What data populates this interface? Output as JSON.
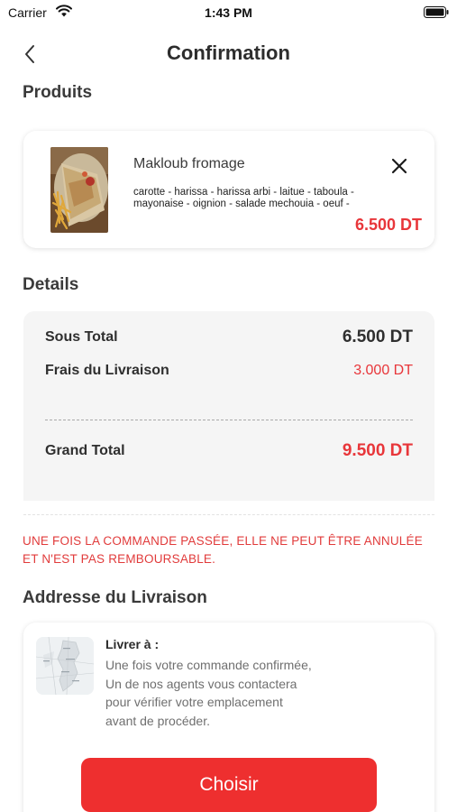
{
  "status_bar": {
    "carrier": "Carrier",
    "time": "1:43 PM"
  },
  "header": {
    "title": "Confirmation",
    "back_icon": "chevron-left-icon"
  },
  "products": {
    "section_title": "Produits",
    "items": [
      {
        "name": "Makloub fromage",
        "ingredients": "carotte - harissa - harissa arbi - laitue - taboula - mayonaise - oignion - salade mechouia - oeuf -",
        "price": "6.500 DT",
        "remove_icon": "close-icon"
      }
    ]
  },
  "details": {
    "section_title": "Details",
    "subtotal_label": "Sous Total",
    "subtotal_value": "6.500 DT",
    "delivery_label": "Frais du Livraison",
    "delivery_value": "3.000 DT",
    "total_label": "Grand Total",
    "total_value": "9.500 DT"
  },
  "warning": "UNE FOIS LA COMMANDE PASSÉE, ELLE NE PEUT ÊTRE ANNULÉE ET N'EST PAS REMBOURSABLE.",
  "address": {
    "section_title": "Addresse du Livraison",
    "deliver_to_label": "Livrer à :",
    "info": "Une fois votre commande confirmée, Un de nos agents vous contactera pour vérifier votre emplacement avant de procéder.",
    "choose_button": "Choisir"
  },
  "colors": {
    "accent": "#ee2f2f",
    "price_red": "#e8363a",
    "details_bg": "#f5f5f5"
  }
}
